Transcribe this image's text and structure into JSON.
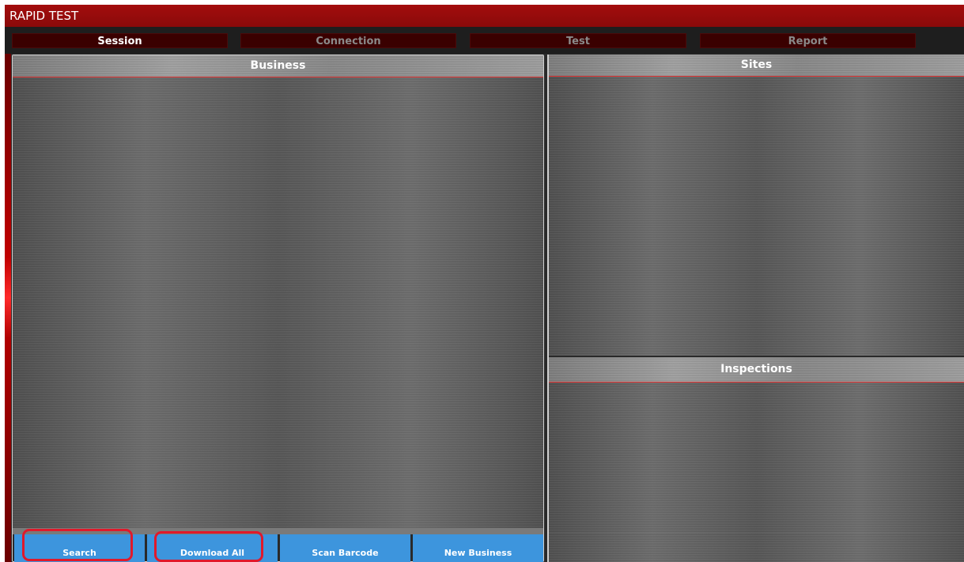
{
  "app": {
    "title": "RAPID TEST"
  },
  "nav": {
    "tabs": [
      {
        "label": "Session",
        "active": true
      },
      {
        "label": "Connection",
        "active": false
      },
      {
        "label": "Test",
        "active": false
      },
      {
        "label": "Report",
        "active": false
      }
    ]
  },
  "business": {
    "header": "Business",
    "buttons": {
      "search": "Search",
      "download_all": "Download All",
      "scan_barcode": "Scan Barcode",
      "new_business": "New Business"
    }
  },
  "sites": {
    "header": "Sites"
  },
  "inspections": {
    "header": "Inspections"
  },
  "colors": {
    "title_bar": "#8a0a0a",
    "tab_bg": "#3a0000",
    "button": "#3d95dd",
    "highlight": "#e0192b"
  }
}
